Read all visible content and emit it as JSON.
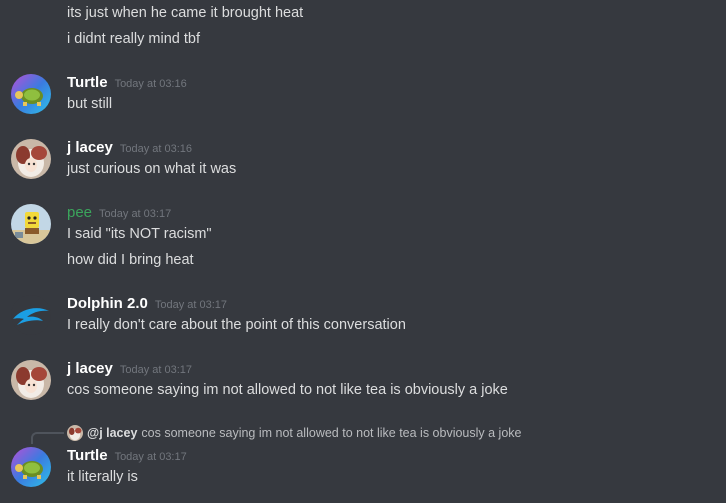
{
  "messages": [
    {
      "type": "continuation",
      "text": "its just when he came it brought heat"
    },
    {
      "type": "continuation",
      "text": "i didnt really mind tbf"
    },
    {
      "type": "group",
      "author": "Turtle",
      "time": "Today at 03:16",
      "lines": [
        "but still"
      ],
      "avatar": "turtle-avatar"
    },
    {
      "type": "group",
      "author": "j lacey",
      "time": "Today at 03:16",
      "lines": [
        "just curious on what it was"
      ],
      "avatar": "anime-avatar"
    },
    {
      "type": "group",
      "author": "pee",
      "author_color": "#3ba55c",
      "time": "Today at 03:17",
      "lines": [
        "I said \"its NOT racism\"",
        "how did I bring heat"
      ],
      "avatar": "cartoon-avatar"
    },
    {
      "type": "group",
      "author": "Dolphin 2.0",
      "time": "Today at 03:17",
      "lines": [
        "I really don't care about the point of this conversation"
      ],
      "avatar": "dolphin-logo-avatar"
    },
    {
      "type": "group",
      "author": "j lacey",
      "time": "Today at 03:17",
      "lines": [
        "cos someone saying im not allowed to not like tea is obviously a joke"
      ],
      "avatar": "anime-avatar"
    },
    {
      "type": "reply-group",
      "reply": {
        "mention": "@j lacey",
        "text": "cos someone saying im not allowed to not like tea is obviously a joke"
      },
      "author": "Turtle",
      "time": "Today at 03:17",
      "lines": [
        "it literally is"
      ],
      "avatar": "turtle-avatar"
    }
  ],
  "colors": {
    "background": "#36393f",
    "message_text": "#dcddde",
    "username": "#ffffff",
    "timestamp": "#72767d",
    "green_username": "#3ba55c",
    "dolphin_blue": "#1b9ee3"
  }
}
